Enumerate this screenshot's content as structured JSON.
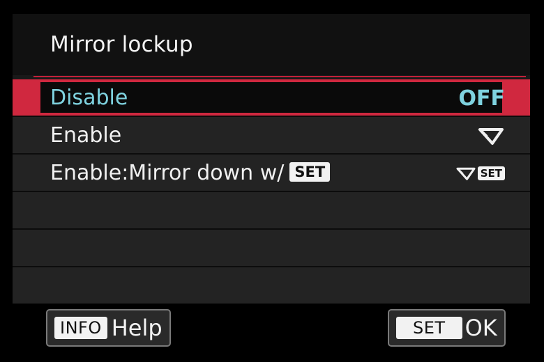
{
  "screen": {
    "title": "Mirror lockup"
  },
  "menu": {
    "items": [
      {
        "label": "Disable",
        "value": "OFF",
        "selected": true
      },
      {
        "label": "Enable",
        "value_icon": "mirror-lockup-icon",
        "selected": false
      },
      {
        "label": "Enable:Mirror down w/",
        "label_badge": "SET",
        "value_icon": "mirror-lockup-icon",
        "value_badge": "SET",
        "selected": false
      }
    ]
  },
  "footer": {
    "info_key": "INFO",
    "info_label": "Help",
    "set_key": "SET",
    "set_label": "OK"
  },
  "colors": {
    "accent": "#d0283f",
    "highlight_text": "#7fd3e0",
    "background": "#191919"
  }
}
